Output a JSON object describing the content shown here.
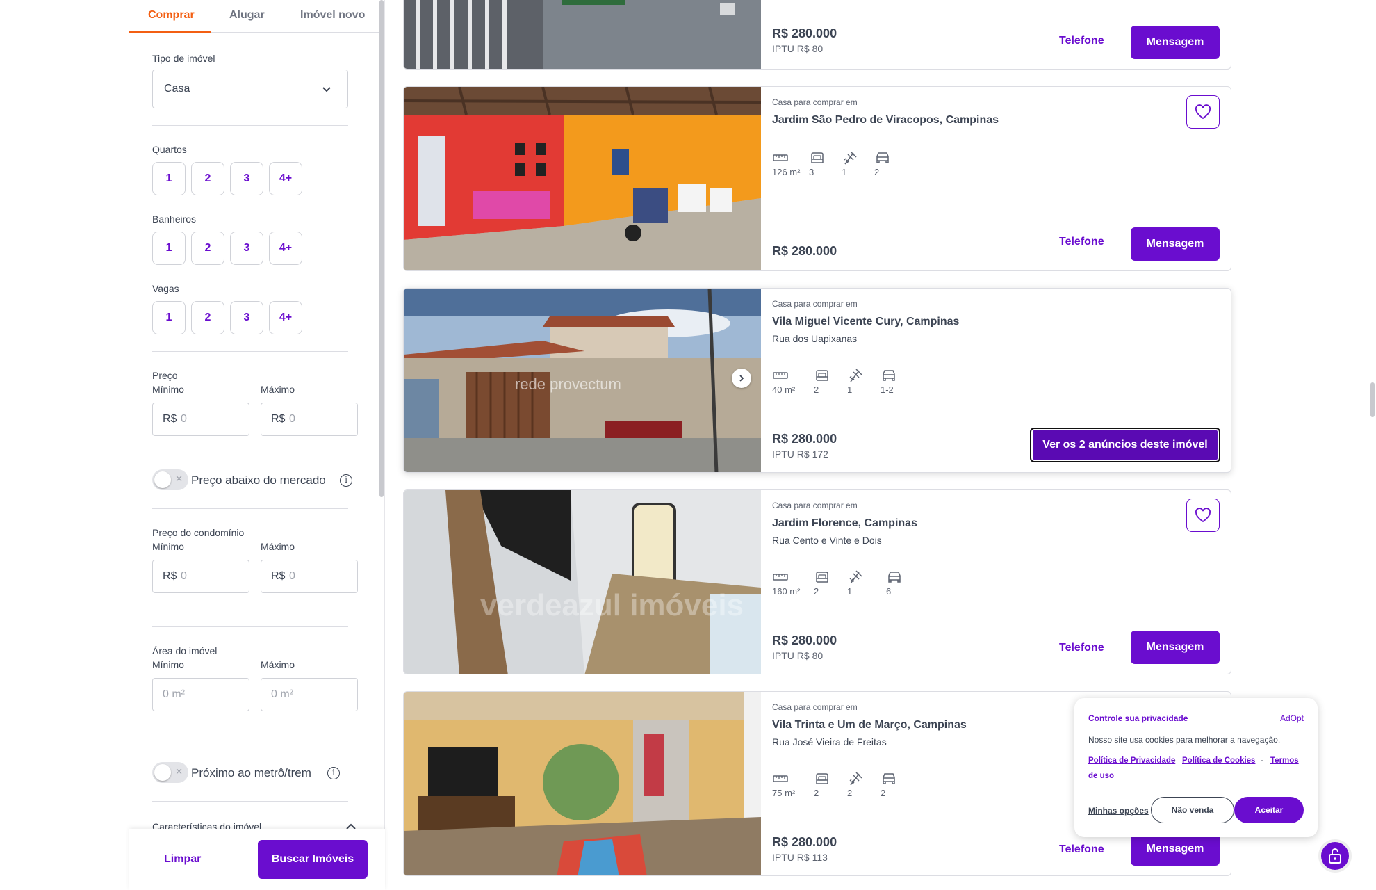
{
  "sidebar": {
    "tabs": [
      "Comprar",
      "Alugar",
      "Imóvel novo"
    ],
    "tipo_label": "Tipo de imóvel",
    "tipo_value": "Casa",
    "quartos_label": "Quartos",
    "banheiros_label": "Banheiros",
    "vagas_label": "Vagas",
    "pill_options": [
      "1",
      "2",
      "3",
      "4+"
    ],
    "preco_label": "Preço",
    "min_label": "Mínimo",
    "max_label": "Máximo",
    "currency_prefix": "R$",
    "zero_placeholder": "0",
    "preco_abaixo_label": "Preço abaixo do mercado",
    "condominio_label": "Preço do condomínio",
    "area_label": "Área do imóvel",
    "area_placeholder": "0 m²",
    "metro_label": "Próximo ao metrô/trem",
    "caracteristicas_label": "Características do imóvel",
    "limpar": "Limpar",
    "buscar": "Buscar Imóveis"
  },
  "listings": [
    {
      "price": "R$ 280.000",
      "iptu": "IPTU R$ 80",
      "telefone": "Telefone",
      "mensagem": "Mensagem"
    },
    {
      "kicker": "Casa para comprar em",
      "address": "Jardim São Pedro de Viracopos, Campinas",
      "street": "",
      "area": "126 m²",
      "quartos": "3",
      "banheiros": "1",
      "vagas": "2",
      "price": "R$ 280.000",
      "iptu": "",
      "telefone": "Telefone",
      "mensagem": "Mensagem"
    },
    {
      "kicker": "Casa para comprar em",
      "address": "Vila Miguel Vicente Cury, Campinas",
      "street": "Rua dos Uapixanas",
      "area": "40 m²",
      "quartos": "2",
      "banheiros": "1",
      "vagas": "1-2",
      "price": "R$ 280.000",
      "iptu": "IPTU R$ 172",
      "ver_anuncios": "Ver os 2 anúncios deste imóvel",
      "watermark": "rede provectum"
    },
    {
      "kicker": "Casa para comprar em",
      "address": "Jardim Florence, Campinas",
      "street": "Rua Cento e Vinte e Dois",
      "area": "160 m²",
      "quartos": "2",
      "banheiros": "1",
      "vagas": "6",
      "price": "R$ 280.000",
      "iptu": "IPTU R$ 80",
      "telefone": "Telefone",
      "mensagem": "Mensagem",
      "watermark": "verdeazul imóveis"
    },
    {
      "kicker": "Casa para comprar em",
      "address": "Vila Trinta e Um de Março, Campinas",
      "street": "Rua José Vieira de Freitas",
      "area": "75 m²",
      "quartos": "2",
      "banheiros": "2",
      "vagas": "2",
      "price": "R$ 280.000",
      "iptu": "IPTU R$ 113",
      "telefone": "Telefone",
      "mensagem": "Mensagem"
    }
  ],
  "cookie": {
    "title": "Controle sua privacidade",
    "brand": "AdOpt",
    "description": "Nosso site usa cookies para melhorar a navegação.",
    "privacy_link": "Política de Privacidade",
    "cookies_link": "Política de Cookies",
    "terms_link_1": "Termos",
    "terms_link_2": "de uso",
    "separator": "-",
    "options": "Minhas opções",
    "no_sale": "Não venda",
    "accept": "Aceitar"
  },
  "icons": [
    "chevron-down-icon",
    "info-icon",
    "ruler-icon",
    "bed-icon",
    "shower-icon",
    "car-icon",
    "heart-icon",
    "chevron-right-icon",
    "lock-open-icon"
  ],
  "colors": {
    "accent": "#6a0dcf",
    "tab_active": "#f35f13",
    "text": "#3c4453"
  }
}
